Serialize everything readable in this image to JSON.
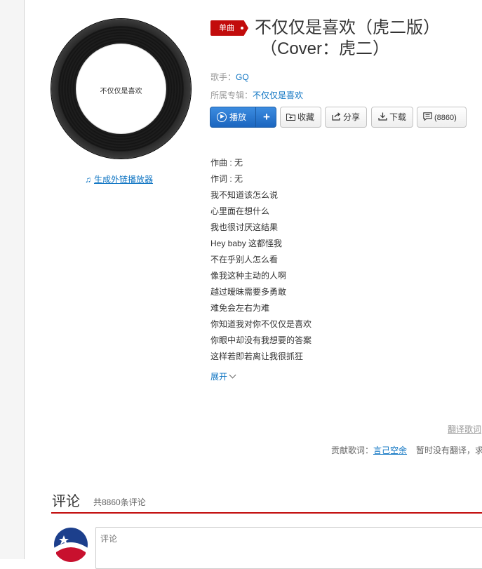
{
  "player": {
    "disc_label": "不仅仅是喜欢",
    "ext_player_link": "生成外链播放器"
  },
  "song": {
    "tag": "单曲",
    "title_line1": "不仅仅是喜欢（虎二版）",
    "title_line2": "（Cover：虎二）",
    "singer_label": "歌手：",
    "singer": "GQ",
    "album_label": "所属专辑：",
    "album": "不仅仅是喜欢"
  },
  "actions": {
    "play": "播放",
    "add": "+",
    "collect": "收藏",
    "share": "分享",
    "download": "下载",
    "comments_count": "(8860)"
  },
  "lyrics": {
    "lines": [
      "作曲 : 无",
      "作词 : 无",
      "我不知道该怎么说",
      "心里面在想什么",
      "我也很讨厌这结果",
      "Hey baby 这都怪我",
      "不在乎别人怎么看",
      "像我这种主动的人啊",
      "越过暧昧需要多勇敢",
      "难免会左右为难",
      "你知道我对你不仅仅是喜欢",
      "你眼中却没有我想要的答案",
      "这样若即若离让我很抓狂"
    ],
    "expand": "展开"
  },
  "footer": {
    "translate_link": "翻译歌词",
    "contrib_label": "贡献歌词：",
    "contributor": "言己空余",
    "no_translation": "暂时没有翻译，求"
  },
  "comments": {
    "title": "评论",
    "count": "共8860条评论",
    "placeholder": "评论"
  },
  "colors": {
    "accent_red": "#c20c0c",
    "link_blue": "#0c73c2",
    "play_blue": "#2b7bd6"
  }
}
